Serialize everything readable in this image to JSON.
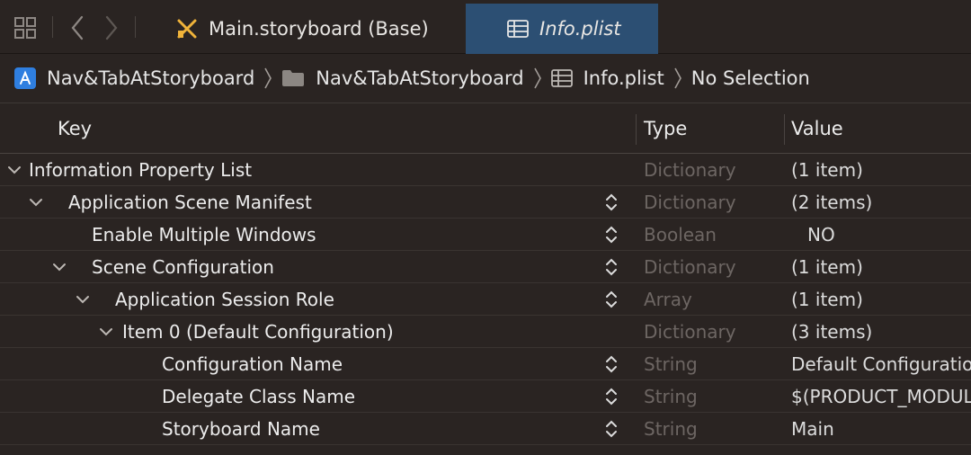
{
  "tabs": {
    "storyboard_label": "Main.storyboard (Base)",
    "plist_label": "Info.plist"
  },
  "jumpbar": {
    "project": "Nav&TabAtStoryboard",
    "folder": "Nav&TabAtStoryboard",
    "file": "Info.plist",
    "selection": "No Selection"
  },
  "columns": {
    "key": "Key",
    "type": "Type",
    "value": "Value"
  },
  "rows": [
    {
      "key": "Information Property List",
      "type": "Dictionary",
      "value": "(1 item)"
    },
    {
      "key": "Application Scene Manifest",
      "type": "Dictionary",
      "value": "(2 items)"
    },
    {
      "key": "Enable Multiple Windows",
      "type": "Boolean",
      "value": "NO"
    },
    {
      "key": "Scene Configuration",
      "type": "Dictionary",
      "value": "(1 item)"
    },
    {
      "key": "Application Session Role",
      "type": "Array",
      "value": "(1 item)"
    },
    {
      "key": "Item 0 (Default Configuration)",
      "type": "Dictionary",
      "value": "(3 items)"
    },
    {
      "key": "Configuration Name",
      "type": "String",
      "value": "Default Configuration"
    },
    {
      "key": "Delegate Class Name",
      "type": "String",
      "value": "$(PRODUCT_MODULE_NAME).SceneDelegate"
    },
    {
      "key": "Storyboard Name",
      "type": "String",
      "value": "Main"
    }
  ],
  "colors": {
    "active_tab": "#2c4f73",
    "background": "#2a2422",
    "type_text": "#6d6663"
  }
}
